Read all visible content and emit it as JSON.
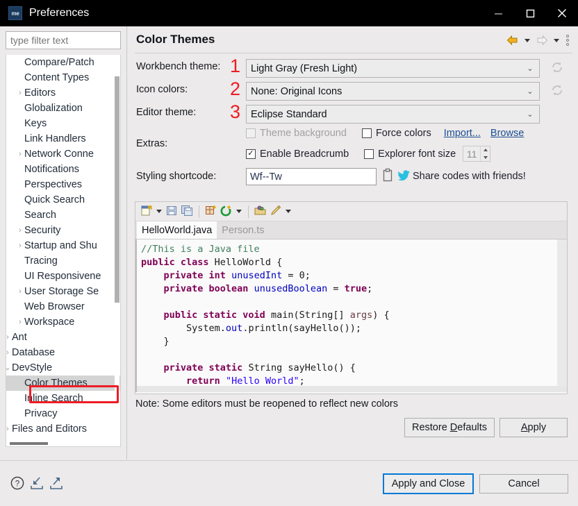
{
  "window": {
    "title": "Preferences",
    "icon": "me-logo-icon",
    "minimize_label": "Minimize",
    "maximize_label": "Maximize",
    "close_label": "Close"
  },
  "sidebar": {
    "filter": {
      "placeholder": "type filter text",
      "value": ""
    },
    "items": [
      {
        "label": "Compare/Patch",
        "indent": 2,
        "arrow": "",
        "selected": false
      },
      {
        "label": "Content Types",
        "indent": 2,
        "arrow": "",
        "selected": false
      },
      {
        "label": "Editors",
        "indent": 2,
        "arrow": "›",
        "selected": false
      },
      {
        "label": "Globalization",
        "indent": 2,
        "arrow": "",
        "selected": false
      },
      {
        "label": "Keys",
        "indent": 2,
        "arrow": "",
        "selected": false
      },
      {
        "label": "Link Handlers",
        "indent": 2,
        "arrow": "",
        "selected": false
      },
      {
        "label": "Network Conne",
        "indent": 2,
        "arrow": "›",
        "selected": false
      },
      {
        "label": "Notifications",
        "indent": 2,
        "arrow": "",
        "selected": false
      },
      {
        "label": "Perspectives",
        "indent": 2,
        "arrow": "",
        "selected": false
      },
      {
        "label": "Quick Search",
        "indent": 2,
        "arrow": "",
        "selected": false
      },
      {
        "label": "Search",
        "indent": 2,
        "arrow": "",
        "selected": false
      },
      {
        "label": "Security",
        "indent": 2,
        "arrow": "›",
        "selected": false
      },
      {
        "label": "Startup and Shu",
        "indent": 2,
        "arrow": "›",
        "selected": false
      },
      {
        "label": "Tracing",
        "indent": 2,
        "arrow": "",
        "selected": false
      },
      {
        "label": "UI Responsivene",
        "indent": 2,
        "arrow": "",
        "selected": false
      },
      {
        "label": "User Storage Se",
        "indent": 2,
        "arrow": "›",
        "selected": false
      },
      {
        "label": "Web Browser",
        "indent": 2,
        "arrow": "",
        "selected": false
      },
      {
        "label": "Workspace",
        "indent": 2,
        "arrow": "›",
        "selected": false
      },
      {
        "label": "Ant",
        "indent": 1,
        "arrow": "›",
        "selected": false
      },
      {
        "label": "Database",
        "indent": 1,
        "arrow": "›",
        "selected": false
      },
      {
        "label": "DevStyle",
        "indent": 1,
        "arrow": "⌄",
        "selected": false
      },
      {
        "label": "Color Themes",
        "indent": 2,
        "arrow": "",
        "selected": true
      },
      {
        "label": "Inline Search",
        "indent": 2,
        "arrow": "",
        "selected": false
      },
      {
        "label": "Privacy",
        "indent": 2,
        "arrow": "",
        "selected": false
      },
      {
        "label": "Files and Editors",
        "indent": 1,
        "arrow": "›",
        "selected": false
      }
    ]
  },
  "panel": {
    "title": "Color Themes",
    "nav": {
      "back_icon": "back-arrow-icon",
      "back_dropdown_icon": "chevron-down-icon",
      "forward_icon": "forward-arrow-icon",
      "forward_dropdown_icon": "chevron-down-icon",
      "menu_icon": "vertical-dots-icon"
    },
    "fields": {
      "workbench_theme": {
        "label": "Workbench theme:",
        "annotation": "1",
        "value": "Light Gray (Fresh Light)",
        "refresh_icon": "refresh-icon"
      },
      "icon_colors": {
        "label": "Icon colors:",
        "annotation": "2",
        "value": "None: Original Icons",
        "refresh_icon": "refresh-icon"
      },
      "editor_theme": {
        "label": "Editor theme:",
        "annotation": "3",
        "value": "Eclipse Standard"
      }
    },
    "extras": {
      "label": "Extras:",
      "theme_background": {
        "label": "Theme background",
        "checked": false,
        "disabled": true
      },
      "force_colors": {
        "label": "Force colors",
        "checked": false,
        "disabled": false
      },
      "import_link": "Import...",
      "browse_link": "Browse",
      "enable_breadcrumb": {
        "label": "Enable Breadcrumb",
        "checked": true,
        "disabled": false
      },
      "explorer_font_size": {
        "label": "Explorer font size",
        "checked": false,
        "disabled": false
      },
      "font_size_value": "11"
    },
    "shortcode": {
      "label": "Styling shortcode:",
      "value": "Wf--Tw",
      "copy_icon": "clipboard-icon",
      "share_icon": "twitter-bird-icon",
      "share_text": "Share codes with friends!"
    },
    "preview": {
      "toolbar_icons": [
        "new-file-icon",
        "chevron-down-icon",
        "save-icon",
        "save-all-icon",
        "separator",
        "new-window-icon",
        "refresh-run-icon",
        "chevron-down-icon",
        "separator",
        "open-package-icon",
        "edit-pen-icon",
        "chevron-down-icon"
      ],
      "tabs": [
        {
          "label": "HelloWorld.java",
          "active": true
        },
        {
          "label": "Person.ts",
          "active": false
        }
      ],
      "code_lines": [
        [
          {
            "t": "//This is a Java file",
            "c": "cmt"
          }
        ],
        [
          {
            "t": "public class ",
            "c": "kw"
          },
          {
            "t": "HelloWorld {",
            "c": "plain"
          }
        ],
        [
          {
            "t": "    ",
            "c": "plain"
          },
          {
            "t": "private int ",
            "c": "kw"
          },
          {
            "t": "unusedInt",
            "c": "fld"
          },
          {
            "t": " = 0;",
            "c": "plain"
          }
        ],
        [
          {
            "t": "    ",
            "c": "plain"
          },
          {
            "t": "private boolean ",
            "c": "kw"
          },
          {
            "t": "unusedBoolean",
            "c": "fld"
          },
          {
            "t": " = ",
            "c": "plain"
          },
          {
            "t": "true",
            "c": "kw"
          },
          {
            "t": ";",
            "c": "plain"
          }
        ],
        [
          {
            "t": "",
            "c": "plain"
          }
        ],
        [
          {
            "t": "    ",
            "c": "plain"
          },
          {
            "t": "public static void ",
            "c": "kw"
          },
          {
            "t": "main(String[] ",
            "c": "plain"
          },
          {
            "t": "args",
            "c": "prm"
          },
          {
            "t": ") {",
            "c": "plain"
          }
        ],
        [
          {
            "t": "        System.",
            "c": "plain"
          },
          {
            "t": "out",
            "c": "fld"
          },
          {
            "t": ".println(sayHello());",
            "c": "plain"
          }
        ],
        [
          {
            "t": "    }",
            "c": "plain"
          }
        ],
        [
          {
            "t": "",
            "c": "plain"
          }
        ],
        [
          {
            "t": "    ",
            "c": "plain"
          },
          {
            "t": "private static ",
            "c": "kw"
          },
          {
            "t": "String sayHello() {",
            "c": "plain"
          }
        ],
        [
          {
            "t": "        ",
            "c": "plain"
          },
          {
            "t": "return ",
            "c": "kw"
          },
          {
            "t": "\"Hello World\"",
            "c": "str"
          },
          {
            "t": ";",
            "c": "plain"
          }
        ],
        [
          {
            "t": "    }",
            "c": "plain"
          }
        ],
        [
          {
            "t": "}",
            "c": "plain"
          }
        ]
      ]
    },
    "note": "Note: Some editors must be reopened to reflect new colors",
    "restore_defaults_label": "Restore Defaults",
    "apply_label": "Apply"
  },
  "footer": {
    "help_icon": "help-question-icon",
    "import_icon": "import-arrow-icon",
    "export_icon": "export-arrow-icon",
    "apply_and_close_label": "Apply and Close",
    "cancel_label": "Cancel"
  },
  "colors": {
    "accent_blue": "#0078d7",
    "annotation_red": "#ee1c25",
    "titlebar_bg": "#000000",
    "panel_bg": "#eceaea",
    "link": "#1c4f96"
  }
}
